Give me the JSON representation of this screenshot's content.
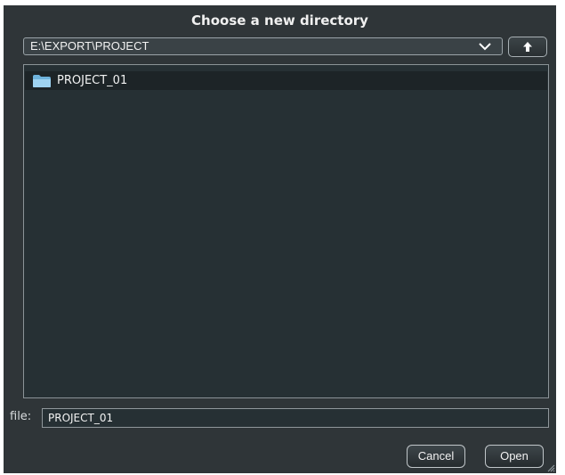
{
  "dialog": {
    "title": "Choose a new directory"
  },
  "path": {
    "value": "E:\\EXPORT\\PROJECT",
    "dropdown_icon": "chevron-down-icon",
    "up_icon": "arrow-up-icon"
  },
  "file_list": {
    "items": [
      {
        "name": "PROJECT_01",
        "icon": "folder-icon",
        "selected": true
      }
    ]
  },
  "file_field": {
    "label": "file:",
    "value": "PROJECT_01"
  },
  "buttons": {
    "cancel": "Cancel",
    "open": "Open"
  },
  "colors": {
    "background": "#2f3538",
    "list_background": "#263034",
    "selection": "#1d2427",
    "folder": "#8ec7ea"
  }
}
